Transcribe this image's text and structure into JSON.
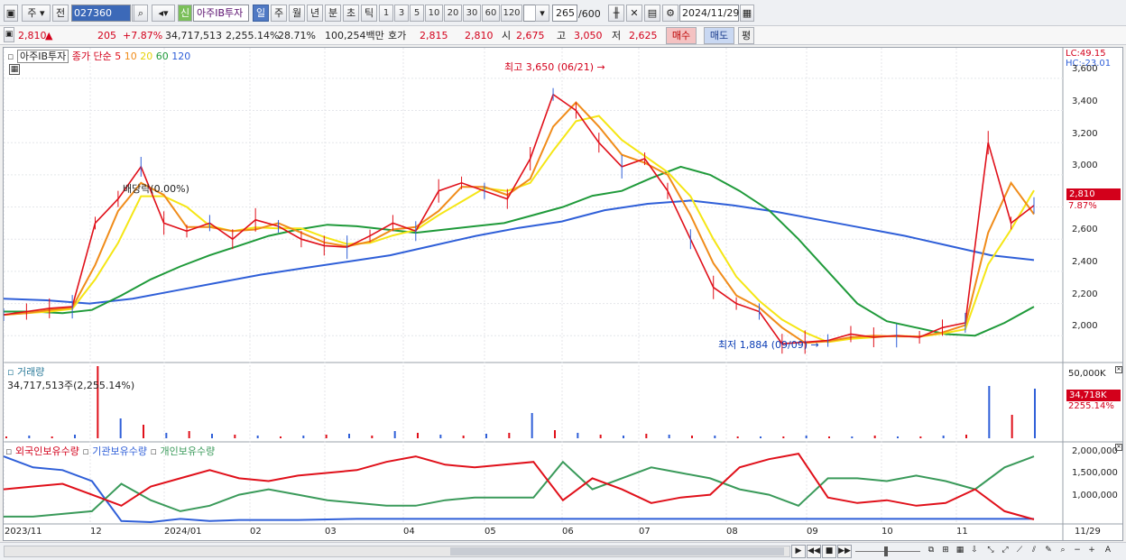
{
  "toolbar": {
    "period_type": "주",
    "prev_label": "전",
    "stock_code": "027360",
    "new_badge": "신",
    "stock_name": "아주IB투자",
    "periods": [
      "일",
      "주",
      "월",
      "년",
      "분",
      "초",
      "틱"
    ],
    "selected_period": "일",
    "intervals": [
      "1",
      "3",
      "5",
      "10",
      "20",
      "30",
      "60",
      "120"
    ],
    "count_value": "265",
    "count_total": "/600",
    "date": "2024/11/29"
  },
  "quote": {
    "price": "2,810",
    "arrow": "▲",
    "change": "205",
    "change_pct": "+7.87%",
    "volume": "34,717,513",
    "volume_pct": "2,255.14%",
    "turnover": "28.71%",
    "amount": "100,254백만",
    "bid_label": "호가",
    "ask_price": "2,815",
    "bid_price": "2,810",
    "open_label": "시",
    "open": "2,675",
    "high_label": "고",
    "high": "3,050",
    "low_label": "저",
    "low": "2,625",
    "buy_label": "매수",
    "sell_label": "매도",
    "eval_label": "평"
  },
  "price_panel": {
    "stock_label": "아주IB투자",
    "ma_label": "종가 단순",
    "ma_periods": [
      "5",
      "10",
      "20",
      "60",
      "120"
    ],
    "ma_colors": [
      "#e0101a",
      "#f08c1a",
      "#f5e615",
      "#1f9a3a",
      "#2f5fd8"
    ],
    "lc": "LC:49.15",
    "hc": "HC:-23.01",
    "high_annotation": "최고 3,650 (06/21)",
    "low_annotation": "최저 1,884 (09/09)",
    "dividend_annotation": "배당락(0.00%)",
    "current_price_tag": "2,810",
    "current_pct_tag": "7.87%",
    "y_ticks": [
      "3,600",
      "3,400",
      "3,200",
      "3,000",
      "2,800",
      "2,600",
      "2,400",
      "2,200",
      "2,000"
    ]
  },
  "volume_panel": {
    "title": "거래량",
    "info": "34,717,513주(2,255.14%)",
    "max_tick": "50,000K",
    "current_tag": "34,718K",
    "current_pct": "2255.14%"
  },
  "holdings_panel": {
    "series": [
      "외국인보유수량",
      "기관보유수량",
      "개인보유수량"
    ],
    "colors": [
      "#e0101a",
      "#2f5fd8",
      "#3a9a5a"
    ],
    "y_ticks": [
      "2,000,000",
      "1,500,000",
      "1,000,000"
    ]
  },
  "x_axis": {
    "labels": [
      "2023/11",
      "12",
      "2024/01",
      "02",
      "03",
      "04",
      "05",
      "06",
      "07",
      "08",
      "09",
      "10",
      "11"
    ],
    "right_label": "11/29"
  },
  "chart_data": {
    "type": "line",
    "title": "",
    "series": [
      {
        "name": "종가",
        "values": [
          2130,
          2150,
          2170,
          2180,
          2700,
          2850,
          3050,
          2700,
          2650,
          2700,
          2600,
          2720,
          2680,
          2600,
          2560,
          2550,
          2620,
          2700,
          2650,
          2900,
          2950,
          2900,
          2850,
          3100,
          3500,
          3400,
          3200,
          3050,
          3100,
          2900,
          2600,
          2300,
          2200,
          2150,
          1950,
          1960,
          1970,
          2010,
          1990,
          2000,
          1990,
          2050,
          2080,
          3200,
          2700,
          2810
        ]
      },
      {
        "name": "60",
        "values": [
          2150,
          2150,
          2140,
          2160,
          2250,
          2350,
          2430,
          2500,
          2560,
          2620,
          2660,
          2690,
          2680,
          2660,
          2640,
          2660,
          2680,
          2700,
          2750,
          2800,
          2870,
          2900,
          2980,
          3050,
          3000,
          2900,
          2780,
          2600,
          2400,
          2200,
          2090,
          2050,
          2010,
          2000,
          2080,
          2180
        ]
      },
      {
        "name": "120",
        "values": [
          2230,
          2220,
          2200,
          2230,
          2280,
          2330,
          2380,
          2420,
          2460,
          2500,
          2560,
          2620,
          2670,
          2710,
          2780,
          2820,
          2840,
          2810,
          2770,
          2720,
          2670,
          2620,
          2560,
          2500,
          2470
        ]
      }
    ],
    "ylim": [
      1850,
      3700
    ],
    "x_range": [
      "2023/11",
      "11/29"
    ]
  }
}
